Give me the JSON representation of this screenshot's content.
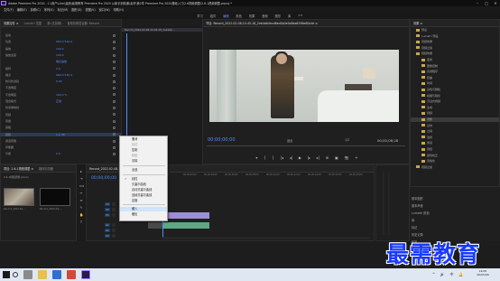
{
  "titlebar": {
    "title": "Adobe Premiere Pro 2020 - C:\\用户\\Lilm\\桌面\\最需教育 Premiere Pro 2020 从新手到精通\\素材\\第2章 Premiere Pro 2020基础入门\\2.6视频调整\\2.6.1视频调整.prproj *",
    "min": "–",
    "max": "□",
    "close": "✕"
  },
  "menubar": {
    "items": [
      "文件(F)",
      "编辑(E)",
      "剪辑(C)",
      "序列(S)",
      "标记(M)",
      "图形(G)",
      "视图(V)",
      "窗口(W)",
      "帮助(H)"
    ]
  },
  "workspaces": {
    "items": [
      "学习",
      "组件",
      "编辑",
      "颜色",
      "效果",
      "音频",
      "图形",
      "库",
      ">>"
    ],
    "active": "编辑"
  },
  "effect_controls": {
    "tabs": [
      "效果控件 ≡",
      "Lumetri 范围",
      "源:(无剪辑)",
      "音频剪辑混合器: Record"
    ],
    "rows": [
      {
        "label": "运动",
        "value": ""
      },
      {
        "label": "位置",
        "value": "960.0  540.0"
      },
      {
        "label": "缩放",
        "value": "100.0"
      },
      {
        "label": "缩放宽度",
        "value": "100.0"
      },
      {
        "label": "",
        "value": "等比缩放"
      },
      {
        "label": "旋转",
        "value": "0.0"
      },
      {
        "label": "锚点",
        "value": "960.0  540.0"
      },
      {
        "label": "防闪烁滤镜",
        "value": "0.00"
      },
      {
        "label": "不透明度",
        "value": ""
      },
      {
        "label": "不透明度",
        "value": "100.0 %"
      },
      {
        "label": "混合模式",
        "value": "正常"
      },
      {
        "label": "时间重映射",
        "value": ""
      },
      {
        "label": "音频",
        "value": ""
      },
      {
        "label": "音量",
        "value": ""
      },
      {
        "label": "旁路",
        "value": ""
      },
      {
        "label": "级别",
        "value": "0.0 dB"
      },
      {
        "label": "通道音量",
        "value": ""
      },
      {
        "label": "声像器",
        "value": ""
      },
      {
        "label": "平衡",
        "value": "0.0"
      }
    ],
    "clip_name": "Record_2022-02-08-10-45-18_2eb4db..."
  },
  "program_monitor": {
    "tab": "节目: Record_2022-02-08-10-45-18_2eb4db4ecd6ed4b4e0c8ea6296e60cde ≡",
    "time_left": "00;00;00;00",
    "fit": "适合",
    "resolution": "1/2",
    "time_right": "00;00;08;28",
    "controls": [
      "▾",
      "{",
      "}",
      "|◂",
      "◂|",
      "▶",
      "|▸",
      "▸|",
      "⊞",
      "▣",
      "📷",
      "+"
    ]
  },
  "project": {
    "tab": "效果 ≡",
    "tree": [
      "预设",
      "Lumetri 预设",
      "音频效果",
      "音频过渡",
      "视频效果",
      "变换",
      "图像控制",
      "实用程序",
      "扭曲",
      "时间",
      "杂色与颗粒",
      "模糊与锐化",
      "沉浸式视频",
      "生成",
      "视频",
      "调整",
      "过时",
      "过渡",
      "透视",
      "通道",
      "键控",
      "颜色校正",
      "风格化",
      "视频过渡"
    ],
    "selected": "调整",
    "side": [
      "基本图形",
      "基本声音",
      "Lumetri 颜色",
      "库",
      "标记",
      "历史记录",
      "信息"
    ]
  },
  "media": {
    "tabs": [
      "项目: 2.6.1视频调整 ≡",
      "媒体浏览器"
    ],
    "file": "2.6.1视频调整.prproj",
    "items": [
      "Record_2022-02-...",
      "Record_2022-02-..."
    ]
  },
  "tools": {
    "items": [
      "▸",
      "⇥",
      "⟺",
      "✂",
      "⇔",
      "✎",
      "✋",
      "T"
    ]
  },
  "timeline": {
    "tab": "Record_2022-02-08-10-45-18_2eb4db... ≡",
    "time": "00;00;00;00",
    "ruler": [
      "00;00",
      "00;00;02;00",
      "00;00;04;00",
      "00;00;06;00",
      "00;00;08;00",
      "00;00;10;00",
      "00;00;12;00",
      "00;00;14;00",
      "00;00;16;00",
      "00;00;18;00"
    ],
    "tracks": [
      "V3",
      "V2",
      "V1",
      "A1",
      "A2",
      "A3"
    ]
  },
  "context_menu": {
    "items": [
      {
        "label": "撤消",
        "enabled": true
      },
      {
        "label": "剪切",
        "enabled": false
      },
      {
        "label": "复制",
        "enabled": true
      },
      {
        "label": "粘贴",
        "enabled": false
      },
      {
        "label": "清除",
        "enabled": true
      },
      {
        "label": "全选",
        "enabled": true
      },
      {
        "label": "线性",
        "enabled": true,
        "checked": true
      },
      {
        "label": "贝塞尔曲线",
        "enabled": true
      },
      {
        "label": "自动贝塞尔曲线",
        "enabled": true
      },
      {
        "label": "连续贝塞尔曲线",
        "enabled": true
      },
      {
        "label": "定格",
        "enabled": true
      },
      {
        "label": "缓入",
        "enabled": true,
        "highlight": true
      },
      {
        "label": "缓出",
        "enabled": true
      }
    ]
  },
  "watermark": "最需教育",
  "taskbar": {
    "clock_time": "16:05",
    "clock_date": "2022/4/6",
    "tray": [
      "^",
      "🔊",
      "中",
      "🔔"
    ]
  },
  "colors": {
    "accent": "#4f8fff",
    "clip_video": "#9c8ed8",
    "clip_audio": "#5da883"
  }
}
